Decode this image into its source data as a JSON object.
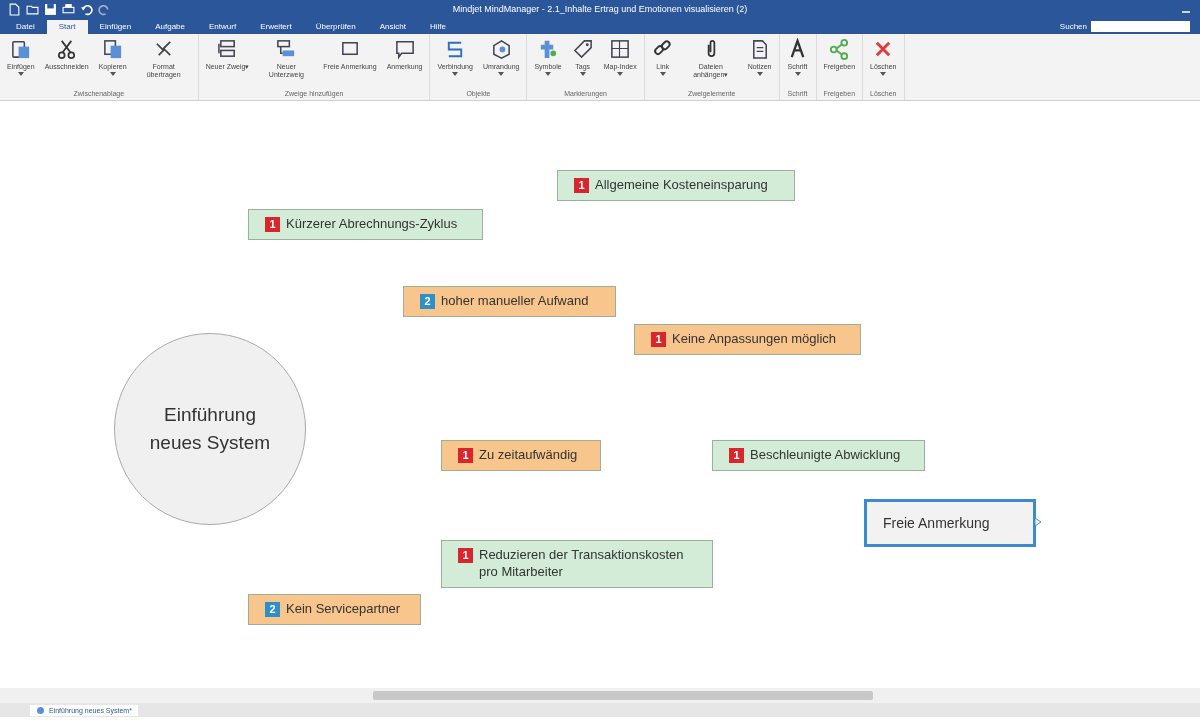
{
  "window": {
    "title": "Mindjet MindManager - 2.1_Inhalte Ertrag und Emotionen visualisieren (2)"
  },
  "tabs": [
    {
      "label": "Datei",
      "selected": false
    },
    {
      "label": "Start",
      "selected": true
    },
    {
      "label": "Einfügen",
      "selected": false
    },
    {
      "label": "Aufgabe",
      "selected": false
    },
    {
      "label": "Entwurf",
      "selected": false
    },
    {
      "label": "Erweitert",
      "selected": false
    },
    {
      "label": "Überprüfen",
      "selected": false
    },
    {
      "label": "Ansicht",
      "selected": false
    },
    {
      "label": "Hilfe",
      "selected": false
    }
  ],
  "search": {
    "label": "Suchen"
  },
  "ribbon": [
    {
      "group": "Zwischenablage",
      "buttons": [
        {
          "label": "Einfügen",
          "dropdown": true
        },
        {
          "label": "Ausschneiden",
          "dropdown": false
        },
        {
          "label": "Kopieren",
          "dropdown": true
        },
        {
          "label": "Format übertragen",
          "dropdown": false
        }
      ]
    },
    {
      "group": "Zweige hinzufügen",
      "buttons": [
        {
          "label": "Neuer Zweig▾",
          "dropdown": false
        },
        {
          "label": "Neuer Unterzweig",
          "dropdown": false
        },
        {
          "label": "Freie Anmerkung",
          "dropdown": false
        },
        {
          "label": "Anmerkung",
          "dropdown": false
        }
      ]
    },
    {
      "group": "Objekte",
      "buttons": [
        {
          "label": "Verbindung",
          "dropdown": true
        },
        {
          "label": "Umrandung",
          "dropdown": true
        }
      ]
    },
    {
      "group": "Markierungen",
      "buttons": [
        {
          "label": "Symbole",
          "dropdown": true
        },
        {
          "label": "Tags",
          "dropdown": true
        },
        {
          "label": "Map-Index",
          "dropdown": true
        }
      ]
    },
    {
      "group": "Zweigelemente",
      "buttons": [
        {
          "label": "Link",
          "dropdown": true
        },
        {
          "label": "Dateien anhängen▾",
          "dropdown": false
        },
        {
          "label": "Notizen",
          "dropdown": true
        }
      ]
    },
    {
      "group": "Schrift",
      "buttons": [
        {
          "label": "Schrift",
          "dropdown": true
        }
      ]
    },
    {
      "group": "Freigeben",
      "buttons": [
        {
          "label": "Freigeben",
          "dropdown": false
        }
      ]
    },
    {
      "group": "Löschen",
      "buttons": [
        {
          "label": "Löschen",
          "dropdown": true
        }
      ]
    }
  ],
  "map": {
    "central_topic": "Einführung neues System",
    "topics": [
      {
        "text": "Allgemeine Kosteneinsparung",
        "priority": "1",
        "color": "#d3ecd8"
      },
      {
        "text": "Kürzerer Abrechnungs-Zyklus",
        "priority": "1",
        "color": "#d3ecd8"
      },
      {
        "text": "hoher manueller Aufwand",
        "priority": "2",
        "color": "#f8c68c"
      },
      {
        "text": "Keine Anpassungen möglich",
        "priority": "1",
        "color": "#f8c68c"
      },
      {
        "text": "Zu zeitaufwändig",
        "priority": "1",
        "color": "#f8c68c"
      },
      {
        "text": "Beschleunigte Abwicklung",
        "priority": "1",
        "color": "#d3ecd8"
      },
      {
        "text": "Reduzieren der Transaktionskosten pro Mitarbeiter",
        "priority": "1",
        "color": "#d3ecd8"
      },
      {
        "text": "Kein Servicepartner",
        "priority": "2",
        "color": "#f8c68c"
      }
    ],
    "free_note": {
      "text": "Freie Anmerkung",
      "selected": true
    }
  },
  "document_tabs": [
    {
      "label": "Einführung neues System*",
      "selected": true
    }
  ]
}
